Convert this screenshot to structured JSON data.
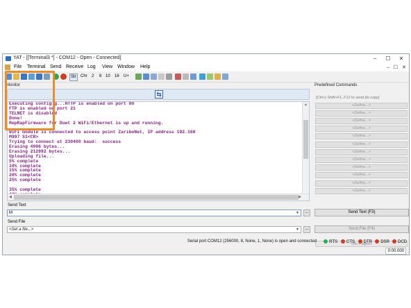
{
  "window": {
    "title": "YAT - [[Terminal3 *] - COM12 - Open - Connected]",
    "min": "–",
    "max": "☐",
    "close": "✕"
  },
  "menu": {
    "items": [
      "File",
      "Terminal",
      "Send",
      "Receive",
      "Log",
      "View",
      "Window",
      "Help"
    ],
    "mdi_min": "–",
    "mdi_max": "☐",
    "mdi_close": "✕"
  },
  "toolbar": {
    "str": "Str",
    "chr": "Chr",
    "n2": "2",
    "n8": "8",
    "n10": "10",
    "n16": "16",
    "u": "U+"
  },
  "monitor": {
    "label": "Monitor",
    "lines": [
      "Executing config.g...HTTP is enabled on port 80",
      "FTP is enabled on port 21",
      "TELNET is disabled",
      "Done!",
      "RepRapFirmware for Duet 2 WiFi/Ethernet is up and running.",
      "",
      "WiFi module is connected to access point ZariboNet, IP address 192.168",
      "M997 S1<CR>",
      "Trying to connect at 230400 baud:  success",
      "Erasing 4096 bytes...",
      "Erasing 212992 bytes...",
      "Uploading file...",
      "5% complete",
      "10% complete",
      "15% complete",
      "20% complete",
      "25% complete",
      "",
      "35% complete",
      "40% complete"
    ]
  },
  "predefined": {
    "label": "Predefined Commands",
    "hint": "[Ctrl+] Shift+F1..F12 to send [to copy]",
    "items": [
      "<Define...>",
      "<Define...>",
      "<Define...>",
      "<Define...>",
      "<Define...>",
      "<Define...>",
      "<Define...>",
      "<Define...>",
      "<Define...>",
      "<Define...>",
      "<Define...>",
      "<Define...>"
    ],
    "pages": "<No Pages>"
  },
  "send_text": {
    "label": "Send Text",
    "value": "M",
    "button": "Send Text (F3)",
    "more": "..."
  },
  "send_file": {
    "label": "Send File",
    "value": "<Set a file...>",
    "button": "Send File (F4)",
    "more": "..."
  },
  "status": {
    "text": "Serial port COM12 (256000, 8, None, 1, None) is open and connected",
    "rts": "RTS",
    "cts": "CTS",
    "dtr": "DTR",
    "dsr": "DSR",
    "dcd": "DCD",
    "timer": "0:00.000",
    "colors": {
      "green": "#22b14c",
      "red": "#d43a1f"
    }
  },
  "accent": {
    "highlight": "#f08a24",
    "terminal_text": "#8a1f8a"
  }
}
